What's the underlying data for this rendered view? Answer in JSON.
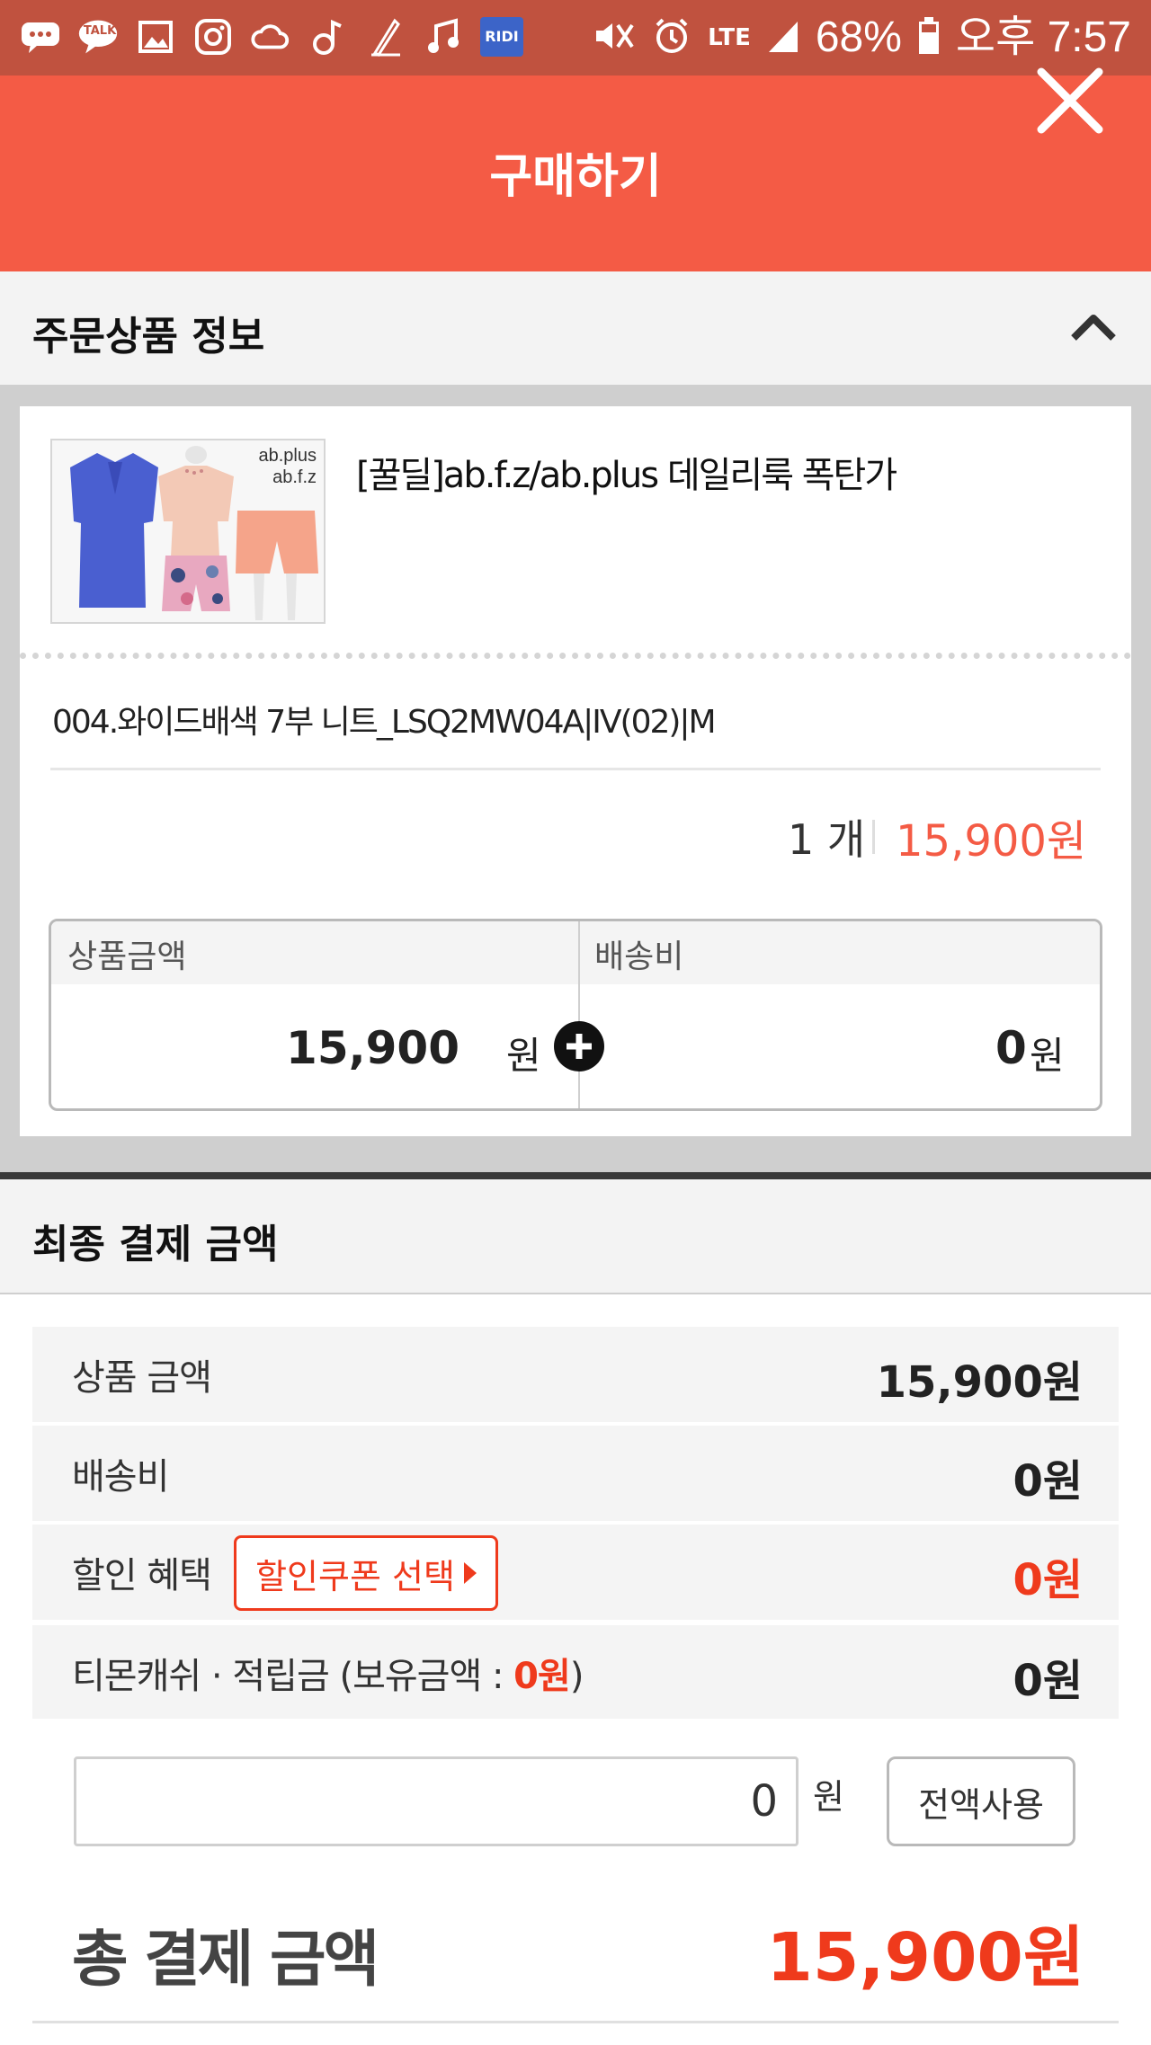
{
  "status_bar": {
    "left_icons": [
      "chat-bubble-icon",
      "kakaotalk-icon",
      "gallery-icon",
      "instagram-icon",
      "cloud-icon",
      "music-note-icon",
      "pen-icon",
      "music-icon",
      "ridi-icon"
    ],
    "talk_label": "TALK",
    "ridi_label": "RIDI",
    "network": "LTE",
    "battery": "68%",
    "time": "오후 7:57"
  },
  "header": {
    "title": "구매하기"
  },
  "order_info": {
    "section_title": "주문상품 정보",
    "thumb_brand_1": "ab.plus",
    "thumb_brand_2": "ab.f.z",
    "product_name": "[꿀딜]ab.f.z/ab.plus 데일리룩 폭탄가",
    "option": "004.와이드배색 7부 니트_LSQ2MW04A|IV(02)|M",
    "quantity": "1 개",
    "line_price": "15,900원",
    "price_box": {
      "product_label": "상품금액",
      "product_value": "15,900",
      "product_unit": "원",
      "shipping_label": "배송비",
      "shipping_value": "0",
      "shipping_unit": "원"
    }
  },
  "final_payment": {
    "section_title": "최종 결제 금액",
    "rows": [
      {
        "label": "상품 금액",
        "value": "15,900원"
      },
      {
        "label": "배송비",
        "value": "0원"
      },
      {
        "label": "할인 혜택",
        "value": "0원",
        "button": "할인쿠폰 선택"
      },
      {
        "label_prefix": "티몬캐쉬 · 적립금 (보유금액 : ",
        "label_amount": "0원",
        "label_suffix": ")",
        "value": "0원"
      }
    ],
    "cash_input_value": "0",
    "cash_unit": "원",
    "use_all_label": "전액사용",
    "total_label": "총 결제 금액",
    "total_value": "15,900원"
  },
  "colors": {
    "status_bar": "#c0523f",
    "header": "#f45b45",
    "accent_red": "#ef3a1c"
  }
}
